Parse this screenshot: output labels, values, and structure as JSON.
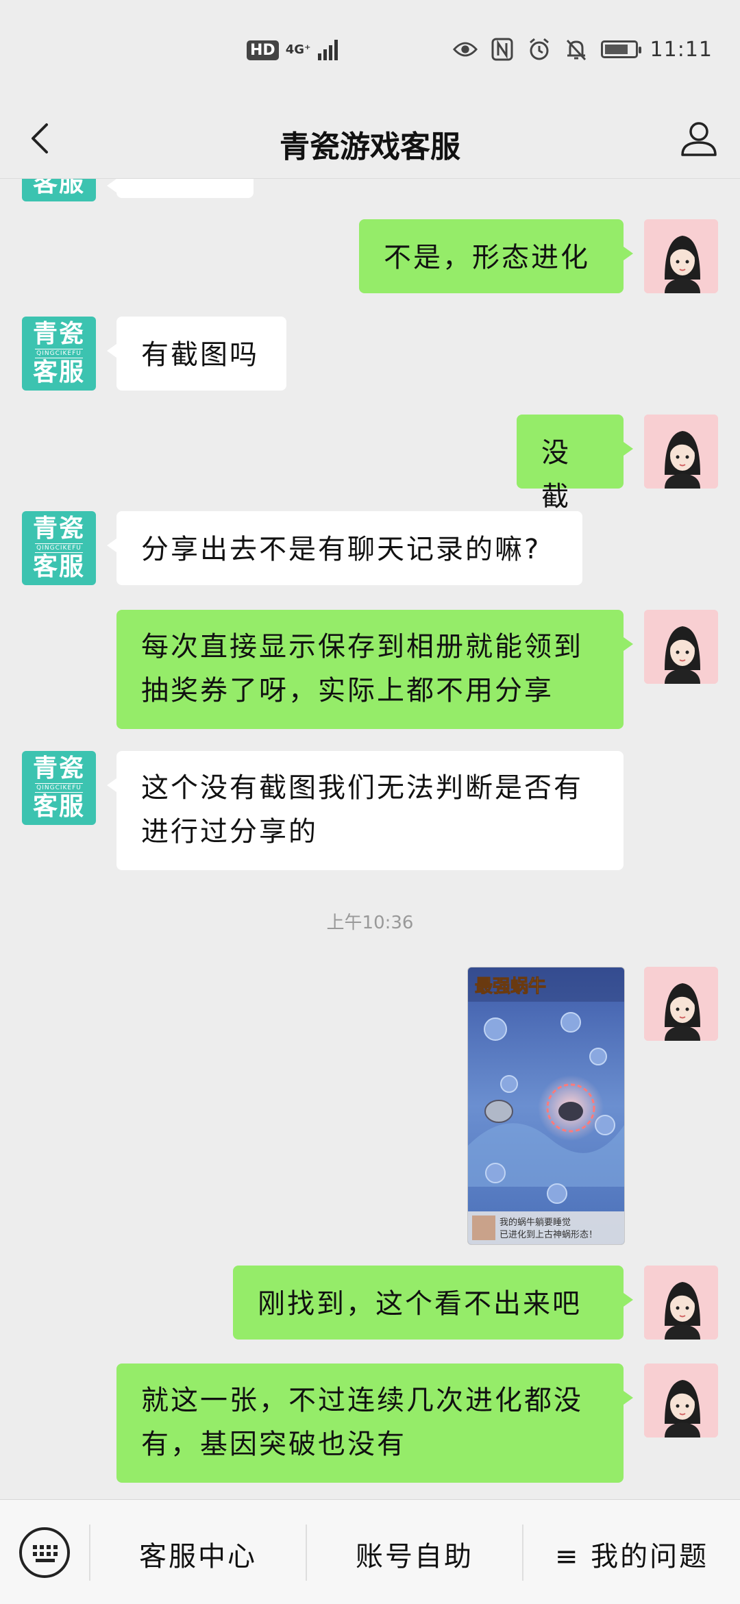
{
  "status_bar": {
    "hd": "HD",
    "network": "4G⁺",
    "time": "11:11",
    "icons": [
      "eye-icon",
      "nfc-icon",
      "alarm-icon",
      "mute-bell-icon",
      "battery-icon"
    ]
  },
  "header": {
    "title": "青瓷游戏客服",
    "back_icon": "chevron-left-icon",
    "profile_icon": "person-icon"
  },
  "service_avatar": {
    "line1": "青瓷",
    "middle": "QINGCIKEFU",
    "line2": "客服"
  },
  "messages": [
    {
      "side": "right",
      "text": "不是，形态进化"
    },
    {
      "side": "left",
      "text": "有截图吗"
    },
    {
      "side": "right",
      "text": "没截"
    },
    {
      "side": "left",
      "text": "分享出去不是有聊天记录的嘛?"
    },
    {
      "side": "right",
      "text": "每次直接显示保存到相册就能领到抽奖券了呀，实际上都不用分享"
    },
    {
      "side": "left",
      "text": "这个没有截图我们无法判断是否有进行过分享的"
    },
    {
      "side": "right",
      "text": "刚找到，这个看不出来吧"
    },
    {
      "side": "right",
      "text": "就这一张，不过连续几次进化都没有，基因突破也没有"
    }
  ],
  "timestamp": "上午10:36",
  "image_message": {
    "game_title": "最强蜗牛",
    "caption_line1": "我的蜗牛躺要睡觉",
    "caption_line2": "已进化到上古神蜗形态！"
  },
  "bottom_bar": {
    "keyboard_icon": "keyboard-icon",
    "item1": "客服中心",
    "item2": "账号自助",
    "item3": "≡ 我的问题"
  },
  "colors": {
    "background": "#ededed",
    "sent_bubble": "#95ec69",
    "received_bubble": "#ffffff",
    "service_avatar": "#3cc3b0",
    "user_avatar_bg": "#f8cfd2"
  }
}
